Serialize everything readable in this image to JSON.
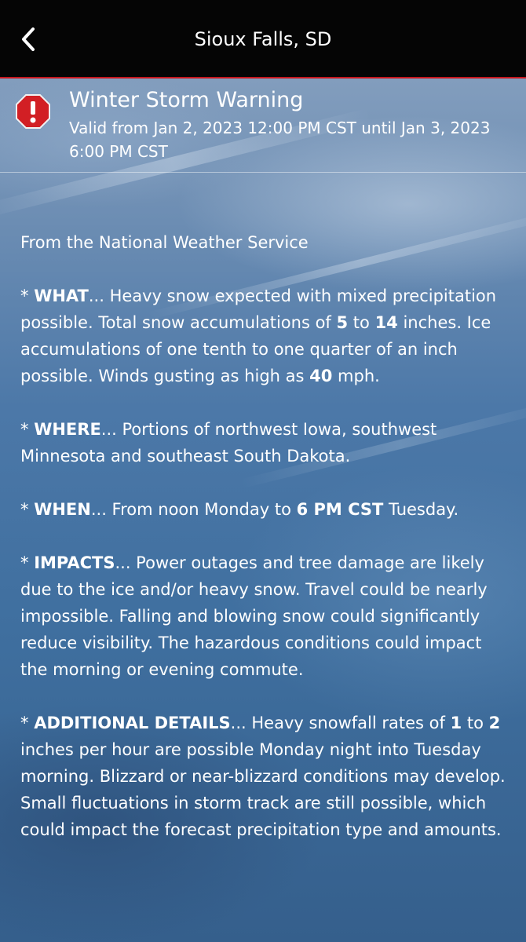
{
  "header": {
    "title": "Sioux Falls, SD"
  },
  "alert": {
    "title": "Winter Storm Warning",
    "valid": "Valid from Jan 2, 2023 12:00 PM CST until Jan 3, 2023 6:00 PM CST"
  },
  "body": {
    "source": "From the National Weather Service",
    "what": {
      "prefix": "* ",
      "label": "WHAT",
      "t1": "... Heavy snow expected with mixed precipitation possible. Total snow accumulations of ",
      "n1": "5",
      "t2": " to ",
      "n2": "14",
      "t3": " inches. Ice accumulations of one tenth to one quarter of an inch possible. Winds gusting as high as ",
      "n3": "40",
      "t4": " mph."
    },
    "where": {
      "prefix": "* ",
      "label": "WHERE",
      "text": "... Portions of northwest Iowa, southwest Minnesota and southeast South Dakota."
    },
    "when": {
      "prefix": "* ",
      "label": "WHEN",
      "t1": "... From noon Monday to ",
      "b1": "6 PM CST",
      "t2": " Tuesday."
    },
    "impacts": {
      "prefix": "* ",
      "label": "IMPACTS",
      "text": "... Power outages and tree damage are likely due to the ice and/or heavy snow. Travel could be nearly impossible. Falling and blowing snow could significantly reduce visibility. The hazardous conditions could impact the morning or evening commute."
    },
    "details": {
      "prefix": "* ",
      "label": "ADDITIONAL DETAILS",
      "t1": "... Heavy snowfall rates of ",
      "n1": "1",
      "t2": " to ",
      "n2": "2",
      "t3": " inches per hour are possible Monday night into Tuesday morning. Blizzard or near-blizzard conditions may develop. Small fluctuations in storm track are still possible, which could impact the forecast precipitation type and amounts."
    }
  },
  "colors": {
    "header_bg": "#050505",
    "accent_red": "#c8161d",
    "text": "#ffffff"
  },
  "icons": {
    "back": "chevron-left-icon",
    "alert": "alert-octagon-icon"
  }
}
